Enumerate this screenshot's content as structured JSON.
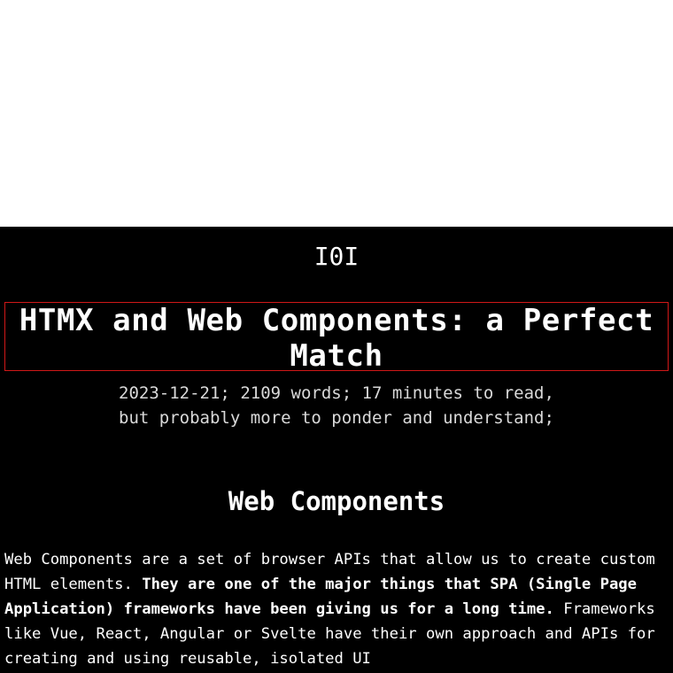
{
  "site": {
    "logo_text": "I0I"
  },
  "article": {
    "title": "HTMX and Web Components: a Perfect Match",
    "meta_line_1": "2023-12-21; 2109 words; 17 minutes to read,",
    "meta_line_2": "but probably more to ponder and understand;",
    "section_heading": "Web Components",
    "paragraph": {
      "text_1": "Web Components are a set of browser APIs that allow us to create custom HTML elements. ",
      "bold_text": "They are one of the major things that SPA (Single Page Application) frameworks have been giving us for a long time.",
      "text_2": " Frameworks like Vue, React, Angular or Svelte have their own approach and APIs for creating and using reusable, isolated UI"
    }
  },
  "colors": {
    "page_background": "#000000",
    "top_background": "#ffffff",
    "text": "#ffffff",
    "meta_text": "#d9d9d9",
    "highlight_border": "#d01818"
  }
}
